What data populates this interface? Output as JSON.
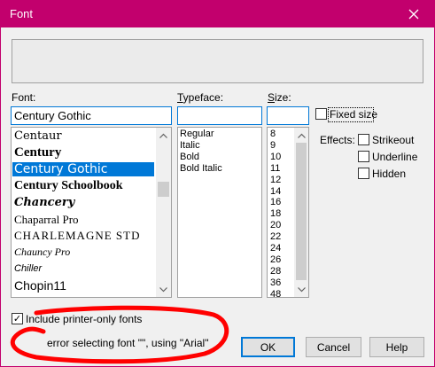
{
  "window": {
    "title": "Font",
    "close_label": "×"
  },
  "font": {
    "label": "Font:",
    "value": "Century Gothic",
    "items": [
      "Centaur",
      "Century",
      "Century Gothic",
      "Century Schoolbook",
      "Chancery",
      "Chaparral Pro",
      "CHARLEMAGNE STD",
      "Chauncy Pro",
      "Chiller",
      "Chopin11"
    ],
    "selected_index": 2
  },
  "typeface": {
    "label": "Typeface:",
    "value": "",
    "items": [
      "Regular",
      "Italic",
      "Bold",
      "Bold Italic"
    ]
  },
  "size": {
    "label": "Size:",
    "value": "",
    "items": [
      "8",
      "9",
      "10",
      "11",
      "12",
      "14",
      "16",
      "18",
      "20",
      "22",
      "24",
      "26",
      "28",
      "36",
      "48"
    ]
  },
  "fixed_size": {
    "label": "Fixed size",
    "checked": false
  },
  "effects": {
    "label": "Effects:",
    "strikeout": {
      "label": "Strikeout",
      "checked": false
    },
    "underline": {
      "label": "Underline",
      "checked": false
    },
    "hidden": {
      "label": "Hidden",
      "checked": false
    }
  },
  "printer_only": {
    "label": "Include printer-only fonts",
    "checked": true,
    "checkmark": "✓"
  },
  "error_message": "error selecting font \"\", using \"Arial\"",
  "buttons": {
    "ok": "OK",
    "cancel": "Cancel",
    "help": "Help"
  },
  "colors": {
    "titlebar": "#c2006d",
    "selection": "#0078d7",
    "annotation_red": "#ff0000"
  }
}
